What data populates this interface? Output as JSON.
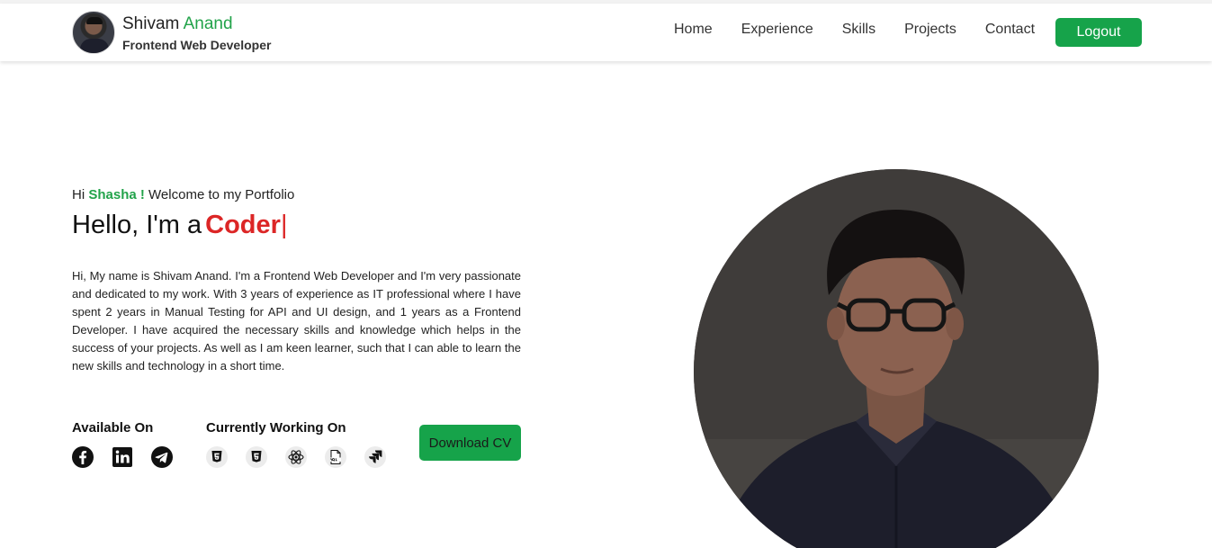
{
  "header": {
    "name_first": "Shivam",
    "name_last": "Anand",
    "subtitle": "Frontend Web Developer",
    "nav": [
      "Home",
      "Experience",
      "Skills",
      "Projects",
      "Contact"
    ],
    "logout_label": "Logout"
  },
  "hero": {
    "greet_prefix": "Hi",
    "visitor": "Shasha !",
    "greet_suffix": "Welcome to my Portfolio",
    "hello_prefix": "Hello, I'm a",
    "role": "Coder",
    "caret": "|",
    "intro": "Hi, My name is Shivam Anand. I'm a Frontend Web Developer and I'm very passionate and dedicated to my work. With 3 years of experience as IT professional where I have spent 2 years in Manual Testing for API and UI design, and 1 years as a Frontend Developer. I have acquired the necessary skills and knowledge which helps in the success of your projects. As well as I am keen learner, such that I can able to learn the new skills and technology in a short time."
  },
  "available": {
    "title": "Available On",
    "icons": [
      "facebook-icon",
      "linkedin-icon",
      "telegram-icon"
    ]
  },
  "working": {
    "title": "Currently Working On",
    "icons": [
      "html5-icon",
      "css3-icon",
      "react-icon",
      "sql-icon",
      "jira-icon"
    ]
  },
  "download_label": "Download CV",
  "colors": {
    "accent_green": "#16a34a",
    "name_green": "#22a34a",
    "role_red": "#dc2626"
  }
}
